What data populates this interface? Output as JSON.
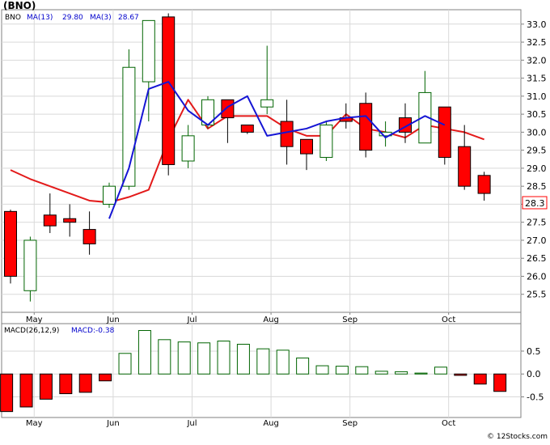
{
  "header": {
    "title": "(BNO)",
    "ticker": "BNO",
    "ma1_label": "MA(13)",
    "ma1_value": "29.80",
    "ma2_label": "MA(3)",
    "ma2_value": "28.67",
    "macd_label": "MACD(26,12,9)",
    "macd_value_label": "MACD:-0.38",
    "last_price": "28.3",
    "watermark": "© 12Stocks.com"
  },
  "colors": {
    "up_fill": "#ffffff",
    "up_stroke": "#006400",
    "down_fill": "#ff0000",
    "ma13": "#e31a1a",
    "ma3": "#1515d4",
    "grid": "#d9d9d9",
    "label_blue": "#0000cc"
  },
  "chart_data": [
    {
      "type": "candlestick",
      "ylim": [
        25.0,
        33.4
      ],
      "yticks": [
        25.5,
        26.0,
        26.5,
        27.0,
        27.5,
        28.0,
        28.5,
        29.0,
        29.5,
        30.0,
        30.5,
        31.0,
        31.5,
        32.0,
        32.5,
        33.0
      ],
      "month_labels": [
        "May",
        "Jun",
        "Jul",
        "Aug",
        "Sep",
        "Oct"
      ],
      "month_positions": [
        1.2,
        5.2,
        9.2,
        13.2,
        17.2,
        22.2
      ],
      "candles": [
        {
          "o": 27.8,
          "h": 27.85,
          "l": 25.8,
          "c": 26.0
        },
        {
          "o": 25.6,
          "h": 27.1,
          "l": 25.3,
          "c": 27.0
        },
        {
          "o": 27.7,
          "h": 28.3,
          "l": 27.2,
          "c": 27.4
        },
        {
          "o": 27.6,
          "h": 28.0,
          "l": 27.1,
          "c": 27.5
        },
        {
          "o": 27.3,
          "h": 27.8,
          "l": 26.6,
          "c": 26.9
        },
        {
          "o": 28.0,
          "h": 28.6,
          "l": 27.9,
          "c": 28.5
        },
        {
          "o": 28.5,
          "h": 32.3,
          "l": 28.4,
          "c": 31.8
        },
        {
          "o": 31.4,
          "h": 33.1,
          "l": 30.3,
          "c": 33.1
        },
        {
          "o": 33.2,
          "h": 33.3,
          "l": 28.8,
          "c": 29.1
        },
        {
          "o": 29.2,
          "h": 30.2,
          "l": 29.0,
          "c": 29.9
        },
        {
          "o": 30.2,
          "h": 31.0,
          "l": 30.1,
          "c": 30.9
        },
        {
          "o": 30.9,
          "h": 30.9,
          "l": 29.7,
          "c": 30.4
        },
        {
          "o": 30.2,
          "h": 30.2,
          "l": 29.95,
          "c": 30.0
        },
        {
          "o": 30.7,
          "h": 32.4,
          "l": 30.5,
          "c": 30.9
        },
        {
          "o": 30.3,
          "h": 30.9,
          "l": 29.1,
          "c": 29.6
        },
        {
          "o": 29.8,
          "h": 29.8,
          "l": 28.95,
          "c": 29.4
        },
        {
          "o": 29.3,
          "h": 30.3,
          "l": 29.2,
          "c": 30.2
        },
        {
          "o": 30.4,
          "h": 30.8,
          "l": 30.1,
          "c": 30.3
        },
        {
          "o": 30.8,
          "h": 31.1,
          "l": 29.3,
          "c": 29.5
        },
        {
          "o": 29.9,
          "h": 30.3,
          "l": 29.6,
          "c": 30.0
        },
        {
          "o": 30.4,
          "h": 30.8,
          "l": 29.7,
          "c": 30.0
        },
        {
          "o": 29.7,
          "h": 31.7,
          "l": 29.7,
          "c": 31.1
        },
        {
          "o": 30.7,
          "h": 30.7,
          "l": 29.1,
          "c": 29.3
        },
        {
          "o": 29.6,
          "h": 30.2,
          "l": 28.4,
          "c": 28.5
        },
        {
          "o": 28.8,
          "h": 28.9,
          "l": 28.1,
          "c": 28.3
        }
      ],
      "series": [
        {
          "name": "MA(13)",
          "x": [
            0,
            1,
            2,
            3,
            4,
            5,
            6,
            7,
            8,
            9,
            10,
            11,
            12,
            13,
            14,
            15,
            16,
            17,
            18,
            19,
            20,
            21,
            22,
            23,
            24
          ],
          "values": [
            28.95,
            28.7,
            28.5,
            28.3,
            28.1,
            28.05,
            28.2,
            28.4,
            29.8,
            30.9,
            30.1,
            30.45,
            30.45,
            30.45,
            30.1,
            29.9,
            29.9,
            30.5,
            30.1,
            30.0,
            29.85,
            30.2,
            30.1,
            30.0,
            29.8
          ]
        },
        {
          "name": "MA(3)",
          "x": [
            5,
            6,
            7,
            8,
            9,
            10,
            11,
            12,
            13,
            14,
            15,
            16,
            17,
            18,
            19,
            20,
            21,
            22
          ],
          "values": [
            27.6,
            29.0,
            31.2,
            31.4,
            30.6,
            30.2,
            30.7,
            31.0,
            29.9,
            30.0,
            30.1,
            30.3,
            30.4,
            30.45,
            29.85,
            30.15,
            30.45,
            30.2
          ]
        }
      ]
    },
    {
      "type": "bar",
      "ylim": [
        -0.95,
        1.1
      ],
      "yticks": [
        -0.5,
        0.0,
        0.5
      ],
      "ytick_labels": [
        "-0.5",
        "0.0",
        "0.5"
      ],
      "month_labels": [
        "May",
        "Jun",
        "Jul",
        "Aug",
        "Sep",
        "Oct"
      ],
      "month_positions": [
        1.2,
        5.2,
        9.2,
        13.2,
        17.2,
        22.2
      ],
      "values": [
        -0.82,
        -0.72,
        -0.55,
        -0.43,
        -0.4,
        -0.15,
        0.45,
        0.95,
        0.75,
        0.7,
        0.68,
        0.72,
        0.65,
        0.55,
        0.52,
        0.35,
        0.18,
        0.17,
        0.16,
        0.06,
        0.05,
        0.02,
        0.15,
        -0.03,
        -0.22,
        -0.38
      ]
    }
  ]
}
